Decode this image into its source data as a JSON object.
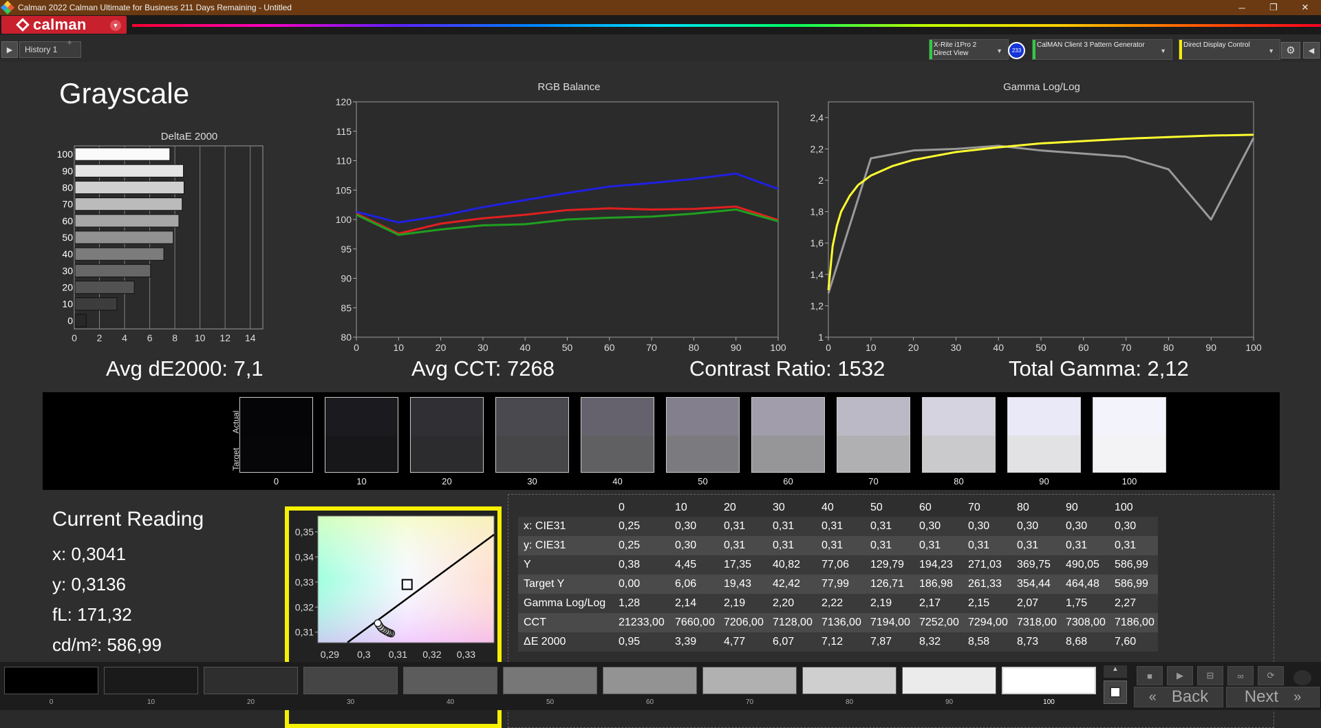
{
  "window": {
    "title": "Calman 2022 Calman Ultimate for Business 211 Days Remaining - Untitled",
    "controls": [
      "─",
      "❐",
      "✕"
    ]
  },
  "brand": {
    "name": "calman",
    "accent": "#c8202d"
  },
  "tabs": {
    "history_label": "History 1",
    "add_label": "+"
  },
  "devices": {
    "meter": {
      "line1": "X-Rite i1Pro 2",
      "line2": "Direct View",
      "accent": "#2ecc40"
    },
    "badge": "233",
    "pattern": {
      "line1": "CalMAN Client 3 Pattern Generator",
      "accent": "#2ecc40"
    },
    "display": {
      "line1": "Direct Display Control",
      "accent": "#f5f000"
    }
  },
  "page_title": "Grayscale",
  "deltae_chart": {
    "title": "DeltaE 2000",
    "categories": [
      "100",
      "90",
      "80",
      "70",
      "60",
      "50",
      "40",
      "30",
      "20",
      "10",
      "0"
    ],
    "values": [
      7.6,
      8.68,
      8.73,
      8.58,
      8.32,
      7.87,
      7.12,
      6.07,
      4.77,
      3.39,
      0.95
    ],
    "x_ticks": [
      "0",
      "2",
      "4",
      "6",
      "8",
      "10",
      "12",
      "14"
    ],
    "xlim": [
      0,
      15
    ]
  },
  "rgb_chart": {
    "title": "RGB Balance",
    "x_ticks": [
      "0",
      "10",
      "20",
      "30",
      "40",
      "50",
      "60",
      "70",
      "80",
      "90",
      "100"
    ],
    "y_ticks": [
      "80",
      "85",
      "90",
      "95",
      "100",
      "105",
      "110",
      "115",
      "120"
    ],
    "xlim": [
      0,
      100
    ],
    "ylim": [
      80,
      120
    ]
  },
  "gamma_chart": {
    "title": "Gamma Log/Log",
    "x_ticks": [
      "0",
      "10",
      "20",
      "30",
      "40",
      "50",
      "60",
      "70",
      "80",
      "90",
      "100"
    ],
    "y_ticks": [
      "1",
      "1,2",
      "1,4",
      "1,6",
      "1,8",
      "2",
      "2,2",
      "2,4"
    ],
    "xlim": [
      0,
      100
    ],
    "ylim": [
      1,
      2.5
    ]
  },
  "chart_data": [
    {
      "type": "bar",
      "title": "DeltaE 2000",
      "categories": [
        "100",
        "90",
        "80",
        "70",
        "60",
        "50",
        "40",
        "30",
        "20",
        "10",
        "0"
      ],
      "values": [
        7.6,
        8.68,
        8.73,
        8.58,
        8.32,
        7.87,
        7.12,
        6.07,
        4.77,
        3.39,
        0.95
      ],
      "xlim": [
        0,
        15
      ]
    },
    {
      "type": "line",
      "title": "RGB Balance",
      "x": [
        0,
        10,
        20,
        30,
        40,
        50,
        60,
        70,
        80,
        90,
        100
      ],
      "series": [
        {
          "color": "#2020e0",
          "values": [
            101.3,
            99.5,
            100.6,
            102.1,
            103.3,
            104.5,
            105.6,
            106.2,
            106.9,
            107.8,
            105.2
          ]
        },
        {
          "color": "#e02020",
          "values": [
            101.0,
            97.6,
            99.3,
            100.2,
            100.8,
            101.6,
            101.9,
            101.7,
            101.8,
            102.2,
            99.9
          ]
        },
        {
          "color": "#20a020",
          "values": [
            100.8,
            97.4,
            98.3,
            99.0,
            99.2,
            100.0,
            100.3,
            100.5,
            101.0,
            101.7,
            99.7
          ]
        }
      ],
      "xlim": [
        0,
        100
      ],
      "ylim": [
        80,
        120
      ]
    },
    {
      "type": "line",
      "title": "Gamma Log/Log",
      "x": [
        0,
        10,
        20,
        30,
        40,
        50,
        60,
        70,
        80,
        90,
        100
      ],
      "series": [
        {
          "color": "#9a9a9a",
          "values": [
            1.28,
            2.14,
            2.19,
            2.2,
            2.22,
            2.19,
            2.17,
            2.15,
            2.07,
            1.75,
            2.27
          ]
        },
        {
          "color": "#ffff30",
          "x": [
            0,
            1,
            2,
            3,
            5,
            7,
            10,
            15,
            20,
            30,
            40,
            50,
            60,
            70,
            80,
            90,
            100
          ],
          "values": [
            1.3,
            1.58,
            1.71,
            1.8,
            1.9,
            1.97,
            2.03,
            2.09,
            2.13,
            2.18,
            2.21,
            2.235,
            2.25,
            2.265,
            2.275,
            2.285,
            2.29
          ]
        }
      ],
      "xlim": [
        0,
        100
      ],
      "ylim": [
        1,
        2.5
      ]
    }
  ],
  "summary": {
    "avg_de": "Avg dE2000: 7,1",
    "avg_cct": "Avg CCT: 7268",
    "contrast": "Contrast Ratio: 1532",
    "gamma": "Total Gamma: 2,12"
  },
  "swatches": {
    "actual_label": "Actual",
    "target_label": "Target",
    "items": [
      {
        "label": "0",
        "actual": "#050507",
        "target": "#060608"
      },
      {
        "label": "10",
        "actual": "#1a1a1f",
        "target": "#17171a"
      },
      {
        "label": "20",
        "actual": "#2f2f34",
        "target": "#2c2c2e"
      },
      {
        "label": "30",
        "actual": "#4a4950",
        "target": "#464648"
      },
      {
        "label": "40",
        "actual": "#66626d",
        "target": "#605f62"
      },
      {
        "label": "50",
        "actual": "#837f8c",
        "target": "#7b7a7e"
      },
      {
        "label": "60",
        "actual": "#a19daa",
        "target": "#969598"
      },
      {
        "label": "70",
        "actual": "#bcb9c6",
        "target": "#b0afb2"
      },
      {
        "label": "80",
        "actual": "#d5d3e0",
        "target": "#cacacc"
      },
      {
        "label": "90",
        "actual": "#e9e9f8",
        "target": "#e2e2e4"
      },
      {
        "label": "100",
        "actual": "#f3f3fc",
        "target": "#f3f3f5"
      }
    ]
  },
  "reading": {
    "title": "Current Reading",
    "x": "x: 0,3041",
    "y": "y: 0,3136",
    "fl": "fL: 171,32",
    "cdm2": "cd/m²: 586,99"
  },
  "cie": {
    "x_ticks": [
      "0,29",
      "0,3",
      "0,31",
      "0,32",
      "0,33"
    ],
    "y_ticks": [
      "0,35",
      "0,34",
      "0,33",
      "0,32",
      "0,31"
    ],
    "xlim": [
      0.2865,
      0.3382
    ],
    "ylim": [
      0.3058,
      0.3563
    ],
    "target": [
      0.3127,
      0.329
    ],
    "points": [
      [
        0.3041,
        0.3136
      ],
      [
        0.3045,
        0.3127
      ],
      [
        0.305,
        0.3118
      ],
      [
        0.3055,
        0.3112
      ],
      [
        0.306,
        0.3108
      ],
      [
        0.3066,
        0.3103
      ],
      [
        0.3071,
        0.31
      ],
      [
        0.3075,
        0.3097
      ],
      [
        0.308,
        0.3095
      ]
    ],
    "locus": [
      [
        0.2952,
        0.3059
      ],
      [
        0.3382,
        0.3489
      ]
    ],
    "frame_color": "#f5f000"
  },
  "table": {
    "columns": [
      "",
      "0",
      "10",
      "20",
      "30",
      "40",
      "50",
      "60",
      "70",
      "80",
      "90",
      "100"
    ],
    "rows": [
      [
        "x: CIE31",
        "0,25",
        "0,30",
        "0,31",
        "0,31",
        "0,31",
        "0,31",
        "0,30",
        "0,30",
        "0,30",
        "0,30",
        "0,30"
      ],
      [
        "y: CIE31",
        "0,25",
        "0,30",
        "0,31",
        "0,31",
        "0,31",
        "0,31",
        "0,31",
        "0,31",
        "0,31",
        "0,31",
        "0,31"
      ],
      [
        "Y",
        "0,38",
        "4,45",
        "17,35",
        "40,82",
        "77,06",
        "129,79",
        "194,23",
        "271,03",
        "369,75",
        "490,05",
        "586,99"
      ],
      [
        "Target Y",
        "0,00",
        "6,06",
        "19,43",
        "42,42",
        "77,99",
        "126,71",
        "186,98",
        "261,33",
        "354,44",
        "464,48",
        "586,99"
      ],
      [
        "Gamma Log/Log",
        "1,28",
        "2,14",
        "2,19",
        "2,20",
        "2,22",
        "2,19",
        "2,17",
        "2,15",
        "2,07",
        "1,75",
        "2,27"
      ],
      [
        "CCT",
        "21233,00",
        "7660,00",
        "7206,00",
        "7128,00",
        "7136,00",
        "7194,00",
        "7252,00",
        "7294,00",
        "7318,00",
        "7308,00",
        "7186,00"
      ],
      [
        "ΔE 2000",
        "0,95",
        "3,39",
        "4,77",
        "6,07",
        "7,12",
        "7,87",
        "8,32",
        "8,58",
        "8,73",
        "8,68",
        "7,60"
      ]
    ]
  },
  "patches": [
    {
      "label": "0",
      "color": "#000000"
    },
    {
      "label": "10",
      "color": "#1a1a1a"
    },
    {
      "label": "20",
      "color": "#2e2e2e"
    },
    {
      "label": "30",
      "color": "#454545"
    },
    {
      "label": "40",
      "color": "#5c5c5c"
    },
    {
      "label": "50",
      "color": "#777777"
    },
    {
      "label": "60",
      "color": "#939393"
    },
    {
      "label": "70",
      "color": "#b1b1b1"
    },
    {
      "label": "80",
      "color": "#cfcfcf"
    },
    {
      "label": "90",
      "color": "#ebebeb"
    },
    {
      "label": "100",
      "color": "#ffffff"
    }
  ],
  "controls": {
    "back_label": "Back",
    "next_label": "Next",
    "back_arrow": "«",
    "next_arrow": "»",
    "up_arrow": "▲",
    "stop_icon": "■",
    "play_icon": "▶",
    "save_icon": "⊟",
    "loop_icon": "∞",
    "refresh_icon": "⟳",
    "play_tab_icon": "▶",
    "settings_icon": "⚙",
    "collapse_icon": "◀",
    "dropdown_icon": "▼"
  }
}
